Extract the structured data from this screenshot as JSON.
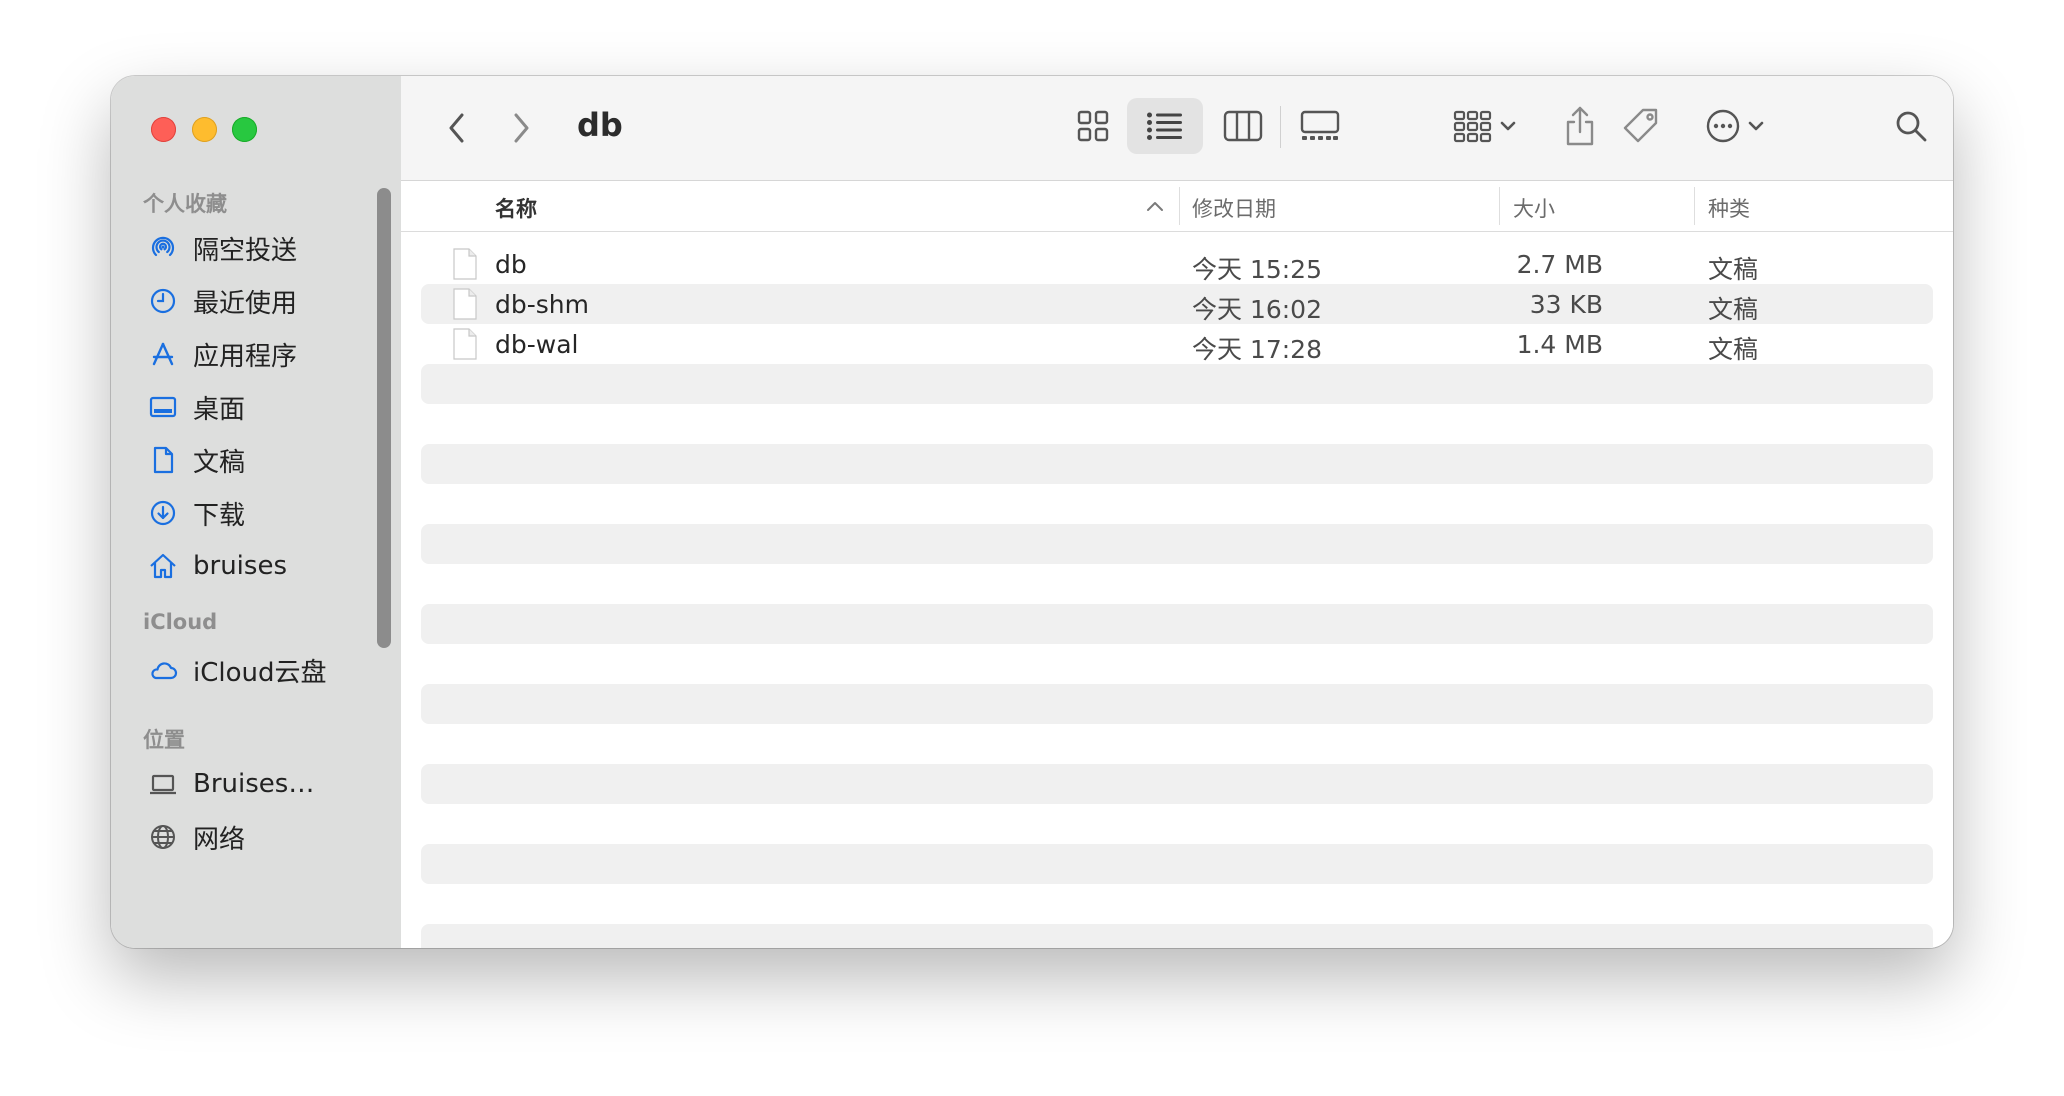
{
  "window": {
    "title": "db"
  },
  "sidebar": {
    "favorites_heading": "个人收藏",
    "favorites": [
      {
        "label": "隔空投送",
        "icon": "airdrop-icon"
      },
      {
        "label": "最近使用",
        "icon": "clock-icon"
      },
      {
        "label": "应用程序",
        "icon": "applications-icon"
      },
      {
        "label": "桌面",
        "icon": "desktop-icon"
      },
      {
        "label": "文稿",
        "icon": "document-icon"
      },
      {
        "label": "下载",
        "icon": "download-icon"
      },
      {
        "label": "bruises",
        "icon": "home-icon"
      }
    ],
    "icloud_heading": "iCloud",
    "icloud": [
      {
        "label": "iCloud云盘",
        "icon": "cloud-icon"
      }
    ],
    "locations_heading": "位置",
    "locations": [
      {
        "label": "Bruises…",
        "icon": "laptop-icon"
      },
      {
        "label": "网络",
        "icon": "globe-icon"
      }
    ]
  },
  "columns": {
    "name": "名称",
    "date": "修改日期",
    "size": "大小",
    "kind": "种类"
  },
  "files": [
    {
      "name": "db",
      "date": "今天 15:25",
      "size": "2.7 MB",
      "kind": "文稿"
    },
    {
      "name": "db-shm",
      "date": "今天 16:02",
      "size": "33 KB",
      "kind": "文稿"
    },
    {
      "name": "db-wal",
      "date": "今天 17:28",
      "size": "1.4 MB",
      "kind": "文稿"
    }
  ],
  "colors": {
    "accent": "#1a6fe0",
    "close": "#fe5f57",
    "minimize": "#febc2e",
    "zoom": "#28c840"
  }
}
